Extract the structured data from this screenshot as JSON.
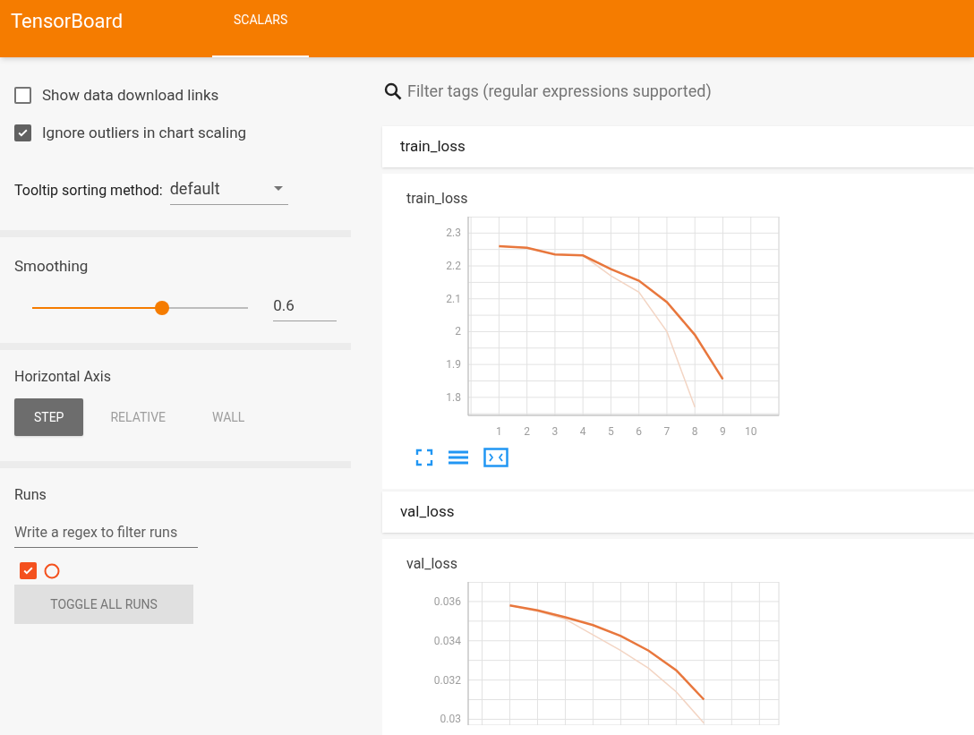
{
  "header": {
    "title": "TensorBoard",
    "tabs": [
      {
        "label": "SCALARS",
        "selected": true
      }
    ]
  },
  "sidebar": {
    "options": [
      {
        "label": "Show data download links",
        "checked": false
      },
      {
        "label": "Ignore outliers in chart scaling",
        "checked": true
      }
    ],
    "tooltip_sorting": {
      "label": "Tooltip sorting method:",
      "value": "default"
    },
    "smoothing": {
      "label": "Smoothing",
      "level": 0.6,
      "value": "0.6"
    },
    "horizontal_axis": {
      "label": "Horizontal Axis",
      "options": [
        {
          "label": "STEP",
          "selected": true
        },
        {
          "label": "RELATIVE",
          "selected": false
        },
        {
          "label": "WALL",
          "selected": false
        }
      ]
    },
    "runs": {
      "label": "Runs",
      "filter_placeholder": "Write a regex to filter runs",
      "items": [
        {
          "checked": true,
          "color": "#f4511e"
        }
      ],
      "toggle_button": "TOGGLE ALL RUNS"
    }
  },
  "main": {
    "search_placeholder": "Filter tags (regular expressions supported)",
    "sections": [
      {
        "title": "train_loss",
        "charts": [
          {
            "title": "train_loss",
            "chart_data": {
              "type": "line",
              "grid": true,
              "x": [
                1,
                2,
                3,
                4,
                5,
                6,
                7,
                8,
                9
              ],
              "xlim": [
                -0.1,
                11
              ],
              "ylim": [
                1.745,
                2.35
              ],
              "xticks": [
                1,
                2,
                3,
                4,
                5,
                6,
                7,
                8,
                9,
                10
              ],
              "yticks": [
                {
                  "value": 1.8,
                  "label": "1.8"
                },
                {
                  "value": 1.9,
                  "label": "1.9"
                },
                {
                  "value": 2,
                  "label": "2"
                },
                {
                  "value": 2.1,
                  "label": "2.1"
                },
                {
                  "value": 2.2,
                  "label": "2.2"
                },
                {
                  "value": 2.3,
                  "label": "2.3"
                }
              ],
              "series": [
                {
                  "color": "#f3d5c4",
                  "values": [
                    2.26,
                    2.255,
                    2.235,
                    2.232,
                    2.17,
                    2.12,
                    2.0,
                    1.77,
                    null
                  ]
                },
                {
                  "color": "#e8773d",
                  "values": [
                    2.26,
                    2.255,
                    2.235,
                    2.232,
                    2.19,
                    2.155,
                    2.09,
                    1.99,
                    1.855
                  ]
                }
              ]
            }
          }
        ]
      },
      {
        "title": "val_loss",
        "charts": [
          {
            "title": "val_loss",
            "chart_data": {
              "type": "line",
              "grid": true,
              "categories": [
                null,
                null,
                null,
                null,
                null,
                null,
                null,
                null
              ],
              "ylim": [
                0.0297,
                0.037
              ],
              "yticks": [
                {
                  "value": 0.03,
                  "label": "0.03"
                },
                {
                  "value": 0.032,
                  "label": "0.032"
                },
                {
                  "value": 0.034,
                  "label": "0.034"
                },
                {
                  "value": 0.036,
                  "label": "0.036"
                }
              ],
              "series": [
                {
                  "color": "#f3d5c4",
                  "values": [
                    0.0358,
                    0.0355,
                    0.0351,
                    0.0343,
                    0.0335,
                    0.0326,
                    0.0314,
                    0.0298
                  ]
                },
                {
                  "color": "#e8773d",
                  "values": [
                    0.0358,
                    0.03555,
                    0.0352,
                    0.0348,
                    0.03425,
                    0.0335,
                    0.0325,
                    0.031
                  ]
                }
              ]
            }
          }
        ]
      }
    ]
  }
}
